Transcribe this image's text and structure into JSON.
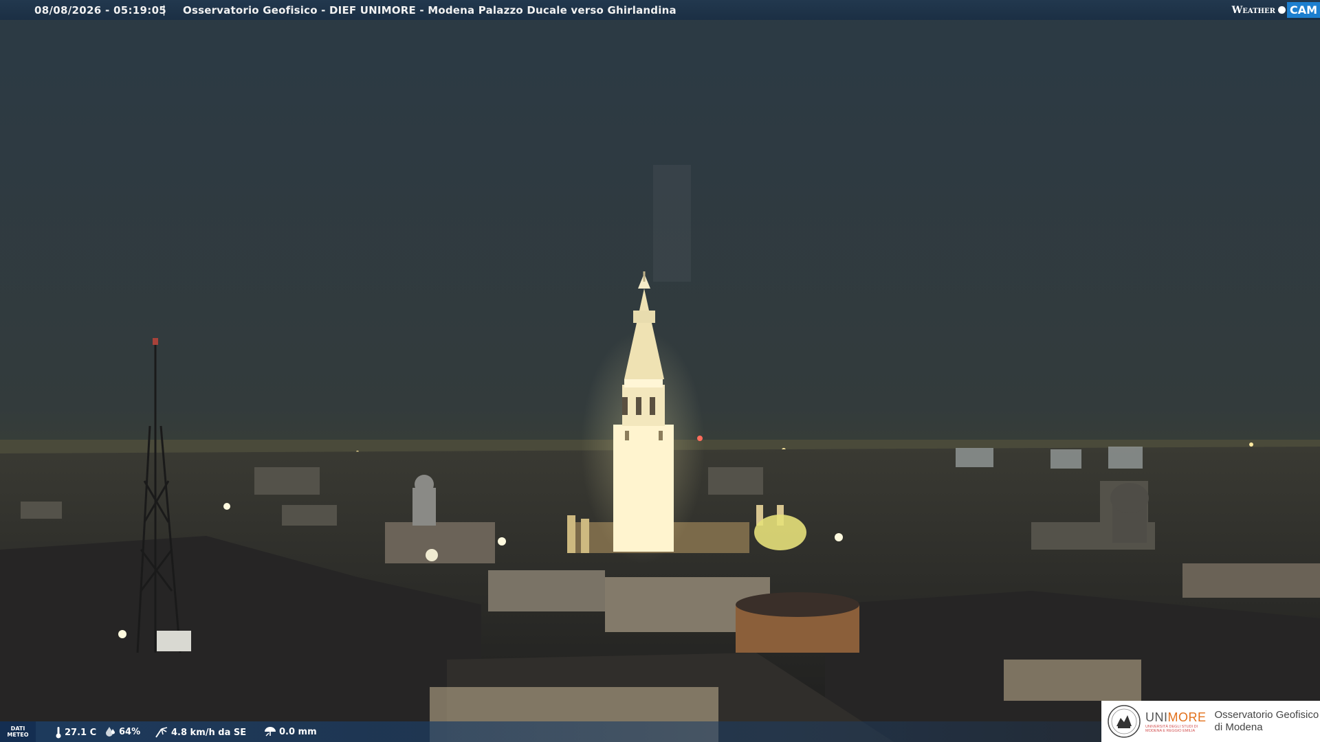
{
  "header": {
    "timestamp": "08/08/2026 - 05:19:05",
    "separator": "|",
    "title": "Osservatorio Geofisico - DIEF UNIMORE - Modena Palazzo Ducale verso Ghirlandina",
    "brand_weather": "Weather",
    "brand_cam": "CAM"
  },
  "footer": {
    "tag_line1": "DATI",
    "tag_line2": "METEO",
    "temperature": "27.1 C",
    "humidity": "64%",
    "wind": "4.8 km/h da SE",
    "rain": "0.0 mm"
  },
  "logo": {
    "uni_part1": "UNI",
    "uni_part2": "MORE",
    "uni_sub1": "UNIVERSITÀ DEGLI STUDI DI",
    "uni_sub2": "MODENA E REGGIO EMILIA",
    "obs_line1": "Osservatorio Geofisico",
    "obs_line2": "di Modena"
  },
  "colors": {
    "bar_blue": "#1b2f44",
    "cam_blue": "#1d7fcf",
    "unimore_orange": "#e2701b",
    "tower_glow": "#fff6cf"
  },
  "icons": [
    "thermometer-icon",
    "humidity-icon",
    "wind-icon",
    "rain-icon",
    "unimore-seal-icon"
  ]
}
